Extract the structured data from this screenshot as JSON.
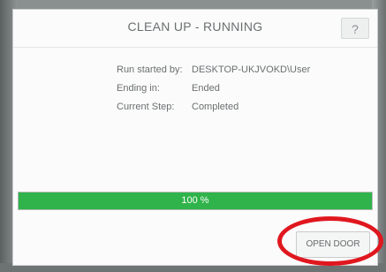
{
  "header": {
    "title": "CLEAN UP - RUNNING",
    "help_label": "?"
  },
  "run_info": {
    "rows": [
      {
        "label": "Run started by:",
        "value": "DESKTOP-UKJVOKD\\User"
      },
      {
        "label": "Ending in:",
        "value": "Ended"
      },
      {
        "label": "Current Step:",
        "value": "Completed"
      }
    ]
  },
  "progress": {
    "value": 100,
    "label": "100 %",
    "fill_color": "#2fb34a"
  },
  "actions": {
    "open_door_label": "OPEN DOOR"
  },
  "annotation": {
    "circle_color": "#e0171f"
  }
}
